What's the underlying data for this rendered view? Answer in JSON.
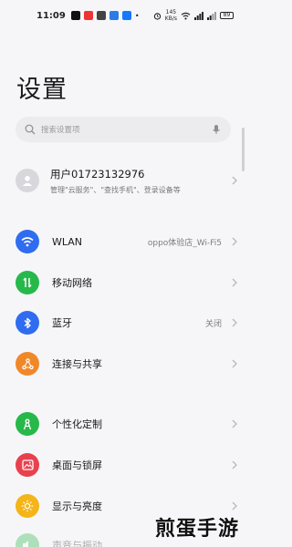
{
  "status": {
    "time": "11:09",
    "network_speed_top": "145",
    "network_speed_bottom": "KB/s",
    "battery": "89"
  },
  "page": {
    "title": "设置"
  },
  "search": {
    "placeholder": "搜索设置项"
  },
  "account": {
    "name": "用户01723132976",
    "subtitle": "管理\"云服务\"、\"查找手机\"、登录设备等"
  },
  "settings": [
    {
      "label": "WLAN",
      "value": "oppo体验店_Wi-Fi5",
      "icon": "wifi-icon",
      "color": "#2f6cf0"
    },
    {
      "label": "移动网络",
      "value": "",
      "icon": "mobile-data-icon",
      "color": "#27b84a"
    },
    {
      "label": "蓝牙",
      "value": "关闭",
      "icon": "bluetooth-icon",
      "color": "#2f6cf0"
    },
    {
      "label": "连接与共享",
      "value": "",
      "icon": "share-icon",
      "color": "#f0882a"
    },
    {
      "label": "个性化定制",
      "value": "",
      "icon": "personalize-icon",
      "color": "#27b84a"
    },
    {
      "label": "桌面与锁屏",
      "value": "",
      "icon": "wallpaper-icon",
      "color": "#e8414e"
    },
    {
      "label": "显示与亮度",
      "value": "",
      "icon": "brightness-icon",
      "color": "#f5b417"
    },
    {
      "label": "声音与振动",
      "value": "",
      "icon": "sound-icon",
      "color": "#27b84a"
    }
  ],
  "watermark": "煎蛋手游"
}
